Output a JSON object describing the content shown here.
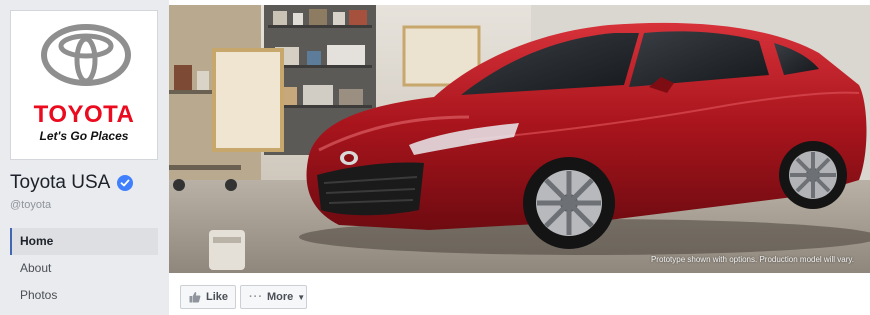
{
  "profile": {
    "logo_name": "toyota-emblem",
    "brand_wordmark": "TOYOTA",
    "tagline": "Let's Go Places",
    "brand_color": "#eb0a1e"
  },
  "page": {
    "name": "Toyota USA",
    "handle": "@toyota",
    "verified_icon": "check-icon",
    "verified_color": "#4080ff"
  },
  "nav": {
    "items": [
      {
        "label": "Home",
        "active": true
      },
      {
        "label": "About",
        "active": false
      },
      {
        "label": "Photos",
        "active": false
      }
    ]
  },
  "cover": {
    "disclaimer": "Prototype shown with options. Production model will vary.",
    "car_color": "#b01a22"
  },
  "actions": {
    "like_label": "Like",
    "like_icon": "thumbs-up-icon",
    "more_label": "More",
    "more_icon": "ellipsis-icon"
  }
}
